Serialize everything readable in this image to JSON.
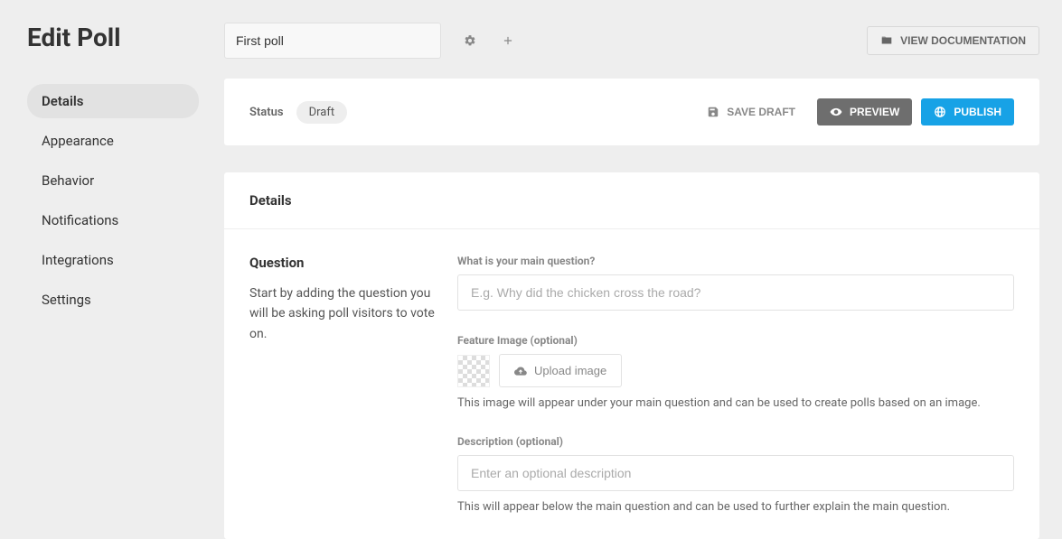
{
  "pageTitle": "Edit Poll",
  "sidebar": {
    "items": [
      {
        "label": "Details",
        "active": true
      },
      {
        "label": "Appearance",
        "active": false
      },
      {
        "label": "Behavior",
        "active": false
      },
      {
        "label": "Notifications",
        "active": false
      },
      {
        "label": "Integrations",
        "active": false
      },
      {
        "label": "Settings",
        "active": false
      }
    ]
  },
  "topbar": {
    "pollName": "First poll",
    "viewDocLabel": "VIEW DOCUMENTATION"
  },
  "status": {
    "label": "Status",
    "value": "Draft",
    "saveDraft": "SAVE DRAFT",
    "preview": "PREVIEW",
    "publish": "PUBLISH"
  },
  "details": {
    "header": "Details",
    "question": {
      "title": "Question",
      "desc": "Start by adding the question you will be asking poll visitors to vote on.",
      "fieldLabel": "What is your main question?",
      "placeholder": "E.g. Why did the chicken cross the road?"
    },
    "featureImage": {
      "label": "Feature Image (optional)",
      "uploadLabel": "Upload image",
      "hint": "This image will appear under your main question and can be used to create polls based on an image."
    },
    "description": {
      "label": "Description (optional)",
      "placeholder": "Enter an optional description",
      "hint": "This will appear below the main question and can be used to further explain the main question."
    }
  }
}
